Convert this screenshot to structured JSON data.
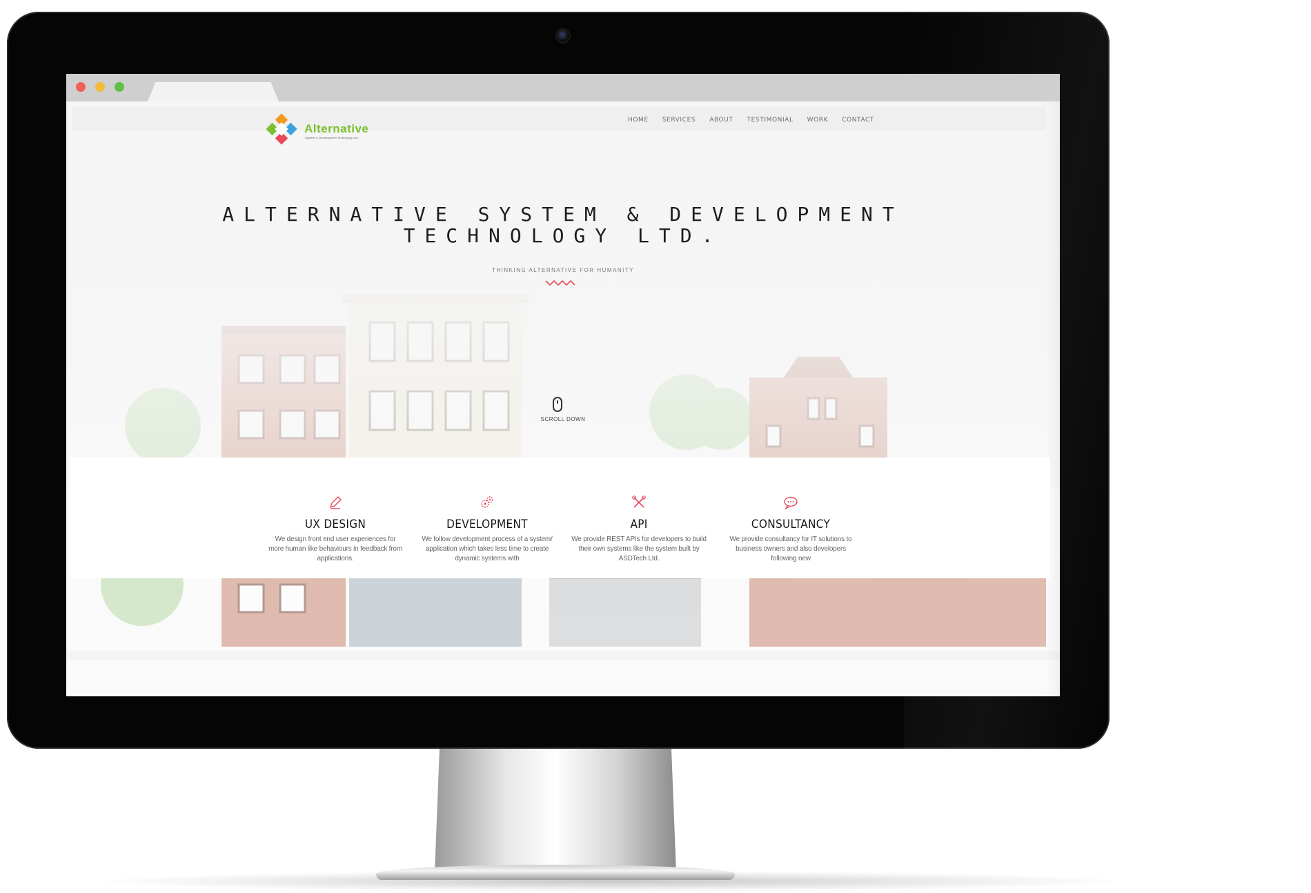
{
  "nav": {
    "items": [
      "HOME",
      "SERVICES",
      "ABOUT",
      "TESTIMONIAL",
      "WORK",
      "CONTACT"
    ]
  },
  "logo": {
    "name": "Alternative",
    "tagline": "System & Development Technology Ltd."
  },
  "hero": {
    "title_line1": "ALTERNATIVE SYSTEM & DEVELOPMENT",
    "title_line2": "TECHNOLOGY LTD.",
    "subtitle": "THINKING ALTERNATIVE FOR HUMANITY",
    "scroll_label": "SCROLL DOWN"
  },
  "services": [
    {
      "icon": "pencil-icon",
      "title": "UX DESIGN",
      "description": "We design front end user experiences for more human like behaviours in feedback from applications."
    },
    {
      "icon": "gears-icon",
      "title": "DEVELOPMENT",
      "description": "We follow development process of a system/ application which takes less time to create dynamic systems with"
    },
    {
      "icon": "tools-icon",
      "title": "API",
      "description": "We provide REST APIs for developers to build their own systems like the system built by ASDTech Ltd."
    },
    {
      "icon": "chat-icon",
      "title": "CONSULTANCY",
      "description": "We provide consultancy for IT solutions to business owners and also developers following new"
    }
  ],
  "colors": {
    "accent": "#e8495a",
    "logo_green": "#7bbf2e",
    "logo_orange": "#f39a1e",
    "logo_blue": "#3aa2dc"
  }
}
